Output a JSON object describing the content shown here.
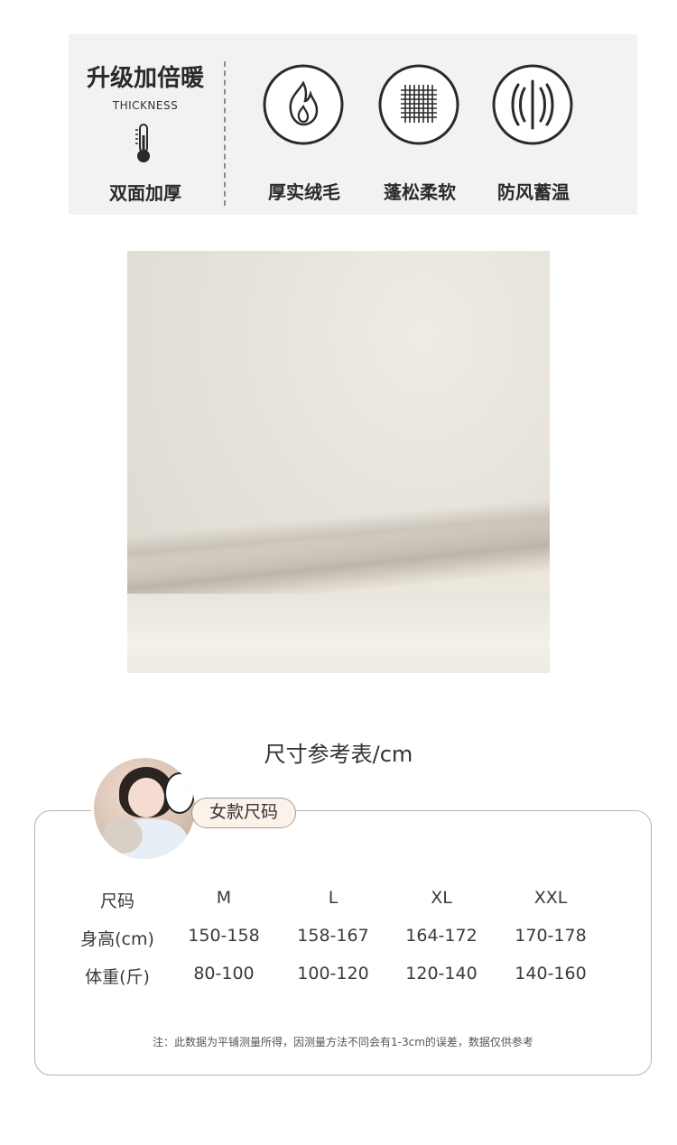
{
  "features": {
    "upgrade_title": "升级加倍暖",
    "upgrade_subtitle": "THICKNESS",
    "upgrade_label": "双面加厚",
    "items": [
      {
        "label": "厚实绒毛",
        "icon": "flame-icon"
      },
      {
        "label": "蓬松柔软",
        "icon": "woven-fabric-icon"
      },
      {
        "label": "防风蓄温",
        "icon": "windproof-lines-icon"
      }
    ]
  },
  "fabric": {
    "icon": "fleece-fabric-closeup"
  },
  "size_chart": {
    "title": "尺寸参考表/cm",
    "tag": "女款尺码",
    "headers": [
      "尺码",
      "M",
      "L",
      "XL",
      "XXL"
    ],
    "rows": [
      [
        "身高(cm)",
        "150-158",
        "158-167",
        "164-172",
        "170-178"
      ],
      [
        "体重(斤)",
        "80-100",
        "100-120",
        "120-140",
        "140-160"
      ]
    ],
    "note": "注：此数据为平铺测量所得，因测量方法不同会有1-3cm的误差，数据仅供参考"
  },
  "colors": {
    "band_bg": "#f3f2f0",
    "text": "#2a2a2a",
    "tag_bg": "#fbf2ea",
    "card_border": "#b9b2ac"
  }
}
